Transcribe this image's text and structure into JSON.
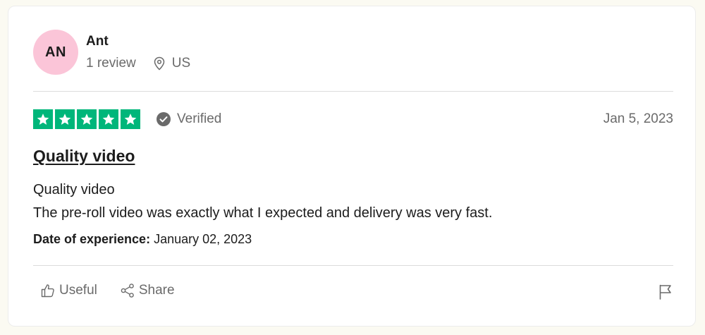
{
  "reviewer": {
    "initials": "AN",
    "name": "Ant",
    "review_count": "1 review",
    "country": "US",
    "avatar_color": "#fbc5d8"
  },
  "review": {
    "stars": 5,
    "star_color": "#00b67a",
    "verified_label": "Verified",
    "date": "Jan 5, 2023",
    "title": "Quality video",
    "body_line1": "Quality video",
    "body_line2": "The pre-roll video was exactly what I expected and delivery was very fast.",
    "experience_label": "Date of experience:",
    "experience_date": "January 02, 2023"
  },
  "actions": {
    "useful_label": "Useful",
    "share_label": "Share"
  },
  "icons": [
    "location-pin-icon",
    "check-circle-icon",
    "star-icon",
    "thumbs-up-icon",
    "share-icon",
    "flag-icon"
  ]
}
